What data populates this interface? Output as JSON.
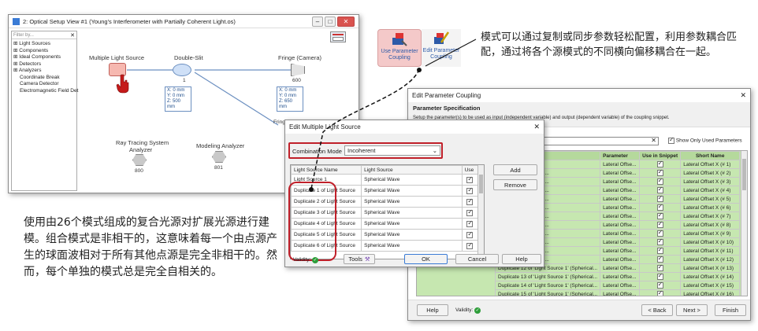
{
  "optical_view": {
    "title": "2: Optical Setup View #1 (Young's Interferometer with Partially Coherent Light.os)",
    "filter_placeholder": "Filter by...",
    "tree": [
      "Light Sources",
      "Components",
      "Ideal Components",
      "Detectors",
      "Analyzers",
      "Coordinate Break",
      "Camera Detector",
      "Electromagnetic Field Det"
    ],
    "nodes": {
      "source": {
        "label": "Multiple Light Source"
      },
      "slit": {
        "label": "Double-Slit",
        "id": "1",
        "coords": [
          "X: 0 mm",
          "Y: 0 mm",
          "Z: 500 mm"
        ]
      },
      "fringe": {
        "label": "Fringe (Camera)",
        "id": "600",
        "coords": [
          "X: 0 mm",
          "Y: 0 mm",
          "Z: 650 mm"
        ]
      },
      "fringe2": {
        "label": "Fringe Along X Axis"
      },
      "raytrace": {
        "label1": "Ray Tracing System",
        "label2": "Analyzer",
        "id": "800"
      },
      "modeling": {
        "label": "Modeling Analyzer",
        "id": "801"
      }
    }
  },
  "toolbar": {
    "use_param": "Use Parameter Coupling",
    "edit_param": "Edit Parameter Coupling"
  },
  "text_right": "模式可以通过复制或同步参数轻松配置，利用参数耦合匹配，通过将各个源模式的不同横向偏移耦合在一起。",
  "text_left": "使用由26个模式组成的复合光源对扩展光源进行建模。组合模式是非相干的，这意味着每一个由点源产生的球面波相对于所有其他点源是完全非相干的。然而，每个单独的模式总是完全自相关的。",
  "param_coupling": {
    "title": "Edit Parameter Coupling",
    "heading": "Parameter Specification",
    "description": "Setup the parameter(s) to be used as input (independent variable) and output (dependent variable) of the coupling snippet.",
    "show_only_used": "Show Only Used Parameters",
    "columns": [
      "...egory",
      "Parameter",
      "Use in Snippet",
      "Short Name"
    ],
    "rows": [
      [
        "...ical Wave)",
        "Lateral Offse...",
        "Lateral Offset X (# 1)"
      ],
      [
        "...ource 1' (Spherical...",
        "Lateral Offse...",
        "Lateral Offset X (# 2)"
      ],
      [
        "...ource 1' (Spherical...",
        "Lateral Offse...",
        "Lateral Offset X (# 3)"
      ],
      [
        "...ource 1' (Spherical...",
        "Lateral Offse...",
        "Lateral Offset X (# 4)"
      ],
      [
        "...ource 1' (Spherical...",
        "Lateral Offse...",
        "Lateral Offset X (# 5)"
      ],
      [
        "...ource 1' (Spherical...",
        "Lateral Offse...",
        "Lateral Offset X (# 6)"
      ],
      [
        "...ource 1' (Spherical...",
        "Lateral Offse...",
        "Lateral Offset X (# 7)"
      ],
      [
        "...ource 1' (Spherical...",
        "Lateral Offse...",
        "Lateral Offset X (# 8)"
      ],
      [
        "...ource 1' (Spherical...",
        "Lateral Offse...",
        "Lateral Offset X (# 9)"
      ],
      [
        "...ource 1' (Spherical...",
        "Lateral Offse...",
        "Lateral Offset X (# 10)"
      ],
      [
        "...ource 1' (Spherical...",
        "Lateral Offse...",
        "Lateral Offset X (# 11)"
      ],
      [
        "...ource 1' (Spherical...",
        "Lateral Offse...",
        "Lateral Offset X (# 12)"
      ],
      [
        "Duplicate 12 of 'Light Source 1' (Spherical...",
        "Lateral Offse...",
        "Lateral Offset X (# 13)"
      ],
      [
        "Duplicate 13 of 'Light Source 1' (Spherical...",
        "Lateral Offse...",
        "Lateral Offset X (# 14)"
      ],
      [
        "Duplicate 14 of 'Light Source 1' (Spherical...",
        "Lateral Offse...",
        "Lateral Offset X (# 15)"
      ],
      [
        "Duplicate 15 of 'Light Source 1' (Spherical...",
        "Lateral Offse...",
        "Lateral Offset X (# 16)"
      ]
    ],
    "help": "Help",
    "validity": "Validity:",
    "back": "< Back",
    "next": "Next >",
    "finish": "Finish"
  },
  "multi_source": {
    "title": "Edit Multiple Light Source",
    "combination_label": "Combination Mode",
    "combination_value": "Incoherent",
    "columns": [
      "Light Source Name",
      "Light Source",
      "Use"
    ],
    "rows": [
      [
        "Light Source 1",
        "Spherical Wave"
      ],
      [
        "Duplicate 1 of Light Source",
        "Spherical Wave"
      ],
      [
        "Duplicate 2 of Light Source",
        "Spherical Wave"
      ],
      [
        "Duplicate 3 of Light Source",
        "Spherical Wave"
      ],
      [
        "Duplicate 4 of Light Source",
        "Spherical Wave"
      ],
      [
        "Duplicate 5 of Light Source",
        "Spherical Wave"
      ],
      [
        "Duplicate 6 of Light Source",
        "Spherical Wave"
      ]
    ],
    "add": "Add",
    "remove": "Remove",
    "validity": "Validity:",
    "tools": "Tools",
    "ok": "OK",
    "cancel": "Cancel",
    "help": "Help"
  }
}
